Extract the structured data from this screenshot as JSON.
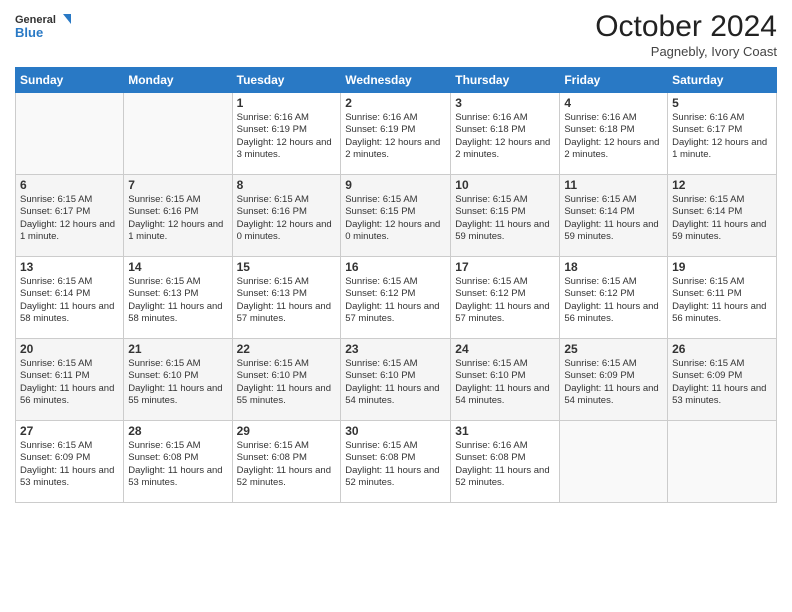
{
  "logo": {
    "line1": "General",
    "line2": "Blue"
  },
  "title": "October 2024",
  "location": "Pagnebly, Ivory Coast",
  "days_of_week": [
    "Sunday",
    "Monday",
    "Tuesday",
    "Wednesday",
    "Thursday",
    "Friday",
    "Saturday"
  ],
  "weeks": [
    [
      {
        "day": "",
        "info": ""
      },
      {
        "day": "",
        "info": ""
      },
      {
        "day": "1",
        "info": "Sunrise: 6:16 AM\nSunset: 6:19 PM\nDaylight: 12 hours and 3 minutes."
      },
      {
        "day": "2",
        "info": "Sunrise: 6:16 AM\nSunset: 6:19 PM\nDaylight: 12 hours and 2 minutes."
      },
      {
        "day": "3",
        "info": "Sunrise: 6:16 AM\nSunset: 6:18 PM\nDaylight: 12 hours and 2 minutes."
      },
      {
        "day": "4",
        "info": "Sunrise: 6:16 AM\nSunset: 6:18 PM\nDaylight: 12 hours and 2 minutes."
      },
      {
        "day": "5",
        "info": "Sunrise: 6:16 AM\nSunset: 6:17 PM\nDaylight: 12 hours and 1 minute."
      }
    ],
    [
      {
        "day": "6",
        "info": "Sunrise: 6:15 AM\nSunset: 6:17 PM\nDaylight: 12 hours and 1 minute."
      },
      {
        "day": "7",
        "info": "Sunrise: 6:15 AM\nSunset: 6:16 PM\nDaylight: 12 hours and 1 minute."
      },
      {
        "day": "8",
        "info": "Sunrise: 6:15 AM\nSunset: 6:16 PM\nDaylight: 12 hours and 0 minutes."
      },
      {
        "day": "9",
        "info": "Sunrise: 6:15 AM\nSunset: 6:15 PM\nDaylight: 12 hours and 0 minutes."
      },
      {
        "day": "10",
        "info": "Sunrise: 6:15 AM\nSunset: 6:15 PM\nDaylight: 11 hours and 59 minutes."
      },
      {
        "day": "11",
        "info": "Sunrise: 6:15 AM\nSunset: 6:14 PM\nDaylight: 11 hours and 59 minutes."
      },
      {
        "day": "12",
        "info": "Sunrise: 6:15 AM\nSunset: 6:14 PM\nDaylight: 11 hours and 59 minutes."
      }
    ],
    [
      {
        "day": "13",
        "info": "Sunrise: 6:15 AM\nSunset: 6:14 PM\nDaylight: 11 hours and 58 minutes."
      },
      {
        "day": "14",
        "info": "Sunrise: 6:15 AM\nSunset: 6:13 PM\nDaylight: 11 hours and 58 minutes."
      },
      {
        "day": "15",
        "info": "Sunrise: 6:15 AM\nSunset: 6:13 PM\nDaylight: 11 hours and 57 minutes."
      },
      {
        "day": "16",
        "info": "Sunrise: 6:15 AM\nSunset: 6:12 PM\nDaylight: 11 hours and 57 minutes."
      },
      {
        "day": "17",
        "info": "Sunrise: 6:15 AM\nSunset: 6:12 PM\nDaylight: 11 hours and 57 minutes."
      },
      {
        "day": "18",
        "info": "Sunrise: 6:15 AM\nSunset: 6:12 PM\nDaylight: 11 hours and 56 minutes."
      },
      {
        "day": "19",
        "info": "Sunrise: 6:15 AM\nSunset: 6:11 PM\nDaylight: 11 hours and 56 minutes."
      }
    ],
    [
      {
        "day": "20",
        "info": "Sunrise: 6:15 AM\nSunset: 6:11 PM\nDaylight: 11 hours and 56 minutes."
      },
      {
        "day": "21",
        "info": "Sunrise: 6:15 AM\nSunset: 6:10 PM\nDaylight: 11 hours and 55 minutes."
      },
      {
        "day": "22",
        "info": "Sunrise: 6:15 AM\nSunset: 6:10 PM\nDaylight: 11 hours and 55 minutes."
      },
      {
        "day": "23",
        "info": "Sunrise: 6:15 AM\nSunset: 6:10 PM\nDaylight: 11 hours and 54 minutes."
      },
      {
        "day": "24",
        "info": "Sunrise: 6:15 AM\nSunset: 6:10 PM\nDaylight: 11 hours and 54 minutes."
      },
      {
        "day": "25",
        "info": "Sunrise: 6:15 AM\nSunset: 6:09 PM\nDaylight: 11 hours and 54 minutes."
      },
      {
        "day": "26",
        "info": "Sunrise: 6:15 AM\nSunset: 6:09 PM\nDaylight: 11 hours and 53 minutes."
      }
    ],
    [
      {
        "day": "27",
        "info": "Sunrise: 6:15 AM\nSunset: 6:09 PM\nDaylight: 11 hours and 53 minutes."
      },
      {
        "day": "28",
        "info": "Sunrise: 6:15 AM\nSunset: 6:08 PM\nDaylight: 11 hours and 53 minutes."
      },
      {
        "day": "29",
        "info": "Sunrise: 6:15 AM\nSunset: 6:08 PM\nDaylight: 11 hours and 52 minutes."
      },
      {
        "day": "30",
        "info": "Sunrise: 6:15 AM\nSunset: 6:08 PM\nDaylight: 11 hours and 52 minutes."
      },
      {
        "day": "31",
        "info": "Sunrise: 6:16 AM\nSunset: 6:08 PM\nDaylight: 11 hours and 52 minutes."
      },
      {
        "day": "",
        "info": ""
      },
      {
        "day": "",
        "info": ""
      }
    ]
  ]
}
